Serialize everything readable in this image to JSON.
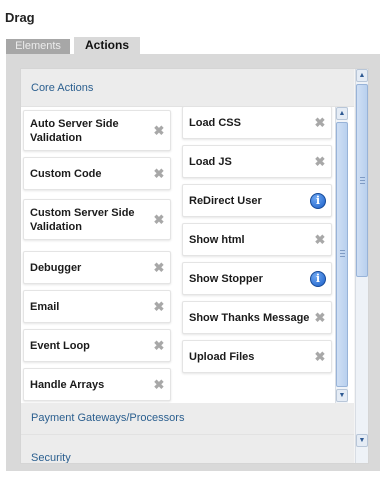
{
  "title": "Drag",
  "tabs": [
    {
      "label": "Elements",
      "active": false
    },
    {
      "label": "Actions",
      "active": true
    }
  ],
  "sections": [
    {
      "label": "Core Actions"
    },
    {
      "label": "Payment Gateways/Processors"
    },
    {
      "label": "Security"
    }
  ],
  "actions_left": [
    {
      "label": "Auto Server Side\nValidation",
      "icon": "close-icon"
    },
    {
      "label": "Custom Code",
      "icon": "close-icon"
    },
    {
      "label": "Custom Server Side\nValidation",
      "icon": "close-icon"
    },
    {
      "label": "Debugger",
      "icon": "close-icon"
    },
    {
      "label": "Email",
      "icon": "close-icon"
    },
    {
      "label": "Event Loop",
      "icon": "close-icon"
    },
    {
      "label": "Handle Arrays",
      "icon": "close-icon"
    }
  ],
  "actions_right": [
    {
      "label": "Load CSS",
      "icon": "close-icon"
    },
    {
      "label": "Load JS",
      "icon": "close-icon"
    },
    {
      "label": "ReDirect User",
      "icon": "info-icon"
    },
    {
      "label": "Show html",
      "icon": "close-icon"
    },
    {
      "label": "Show Stopper",
      "icon": "info-icon"
    },
    {
      "label": "Show Thanks Message",
      "icon": "close-icon"
    },
    {
      "label": "Upload Files",
      "icon": "close-icon"
    }
  ],
  "colors": {
    "accent_arrow": "#e00000",
    "section_text": "#2b5f8f",
    "info_blue": "#1b5fc8"
  }
}
